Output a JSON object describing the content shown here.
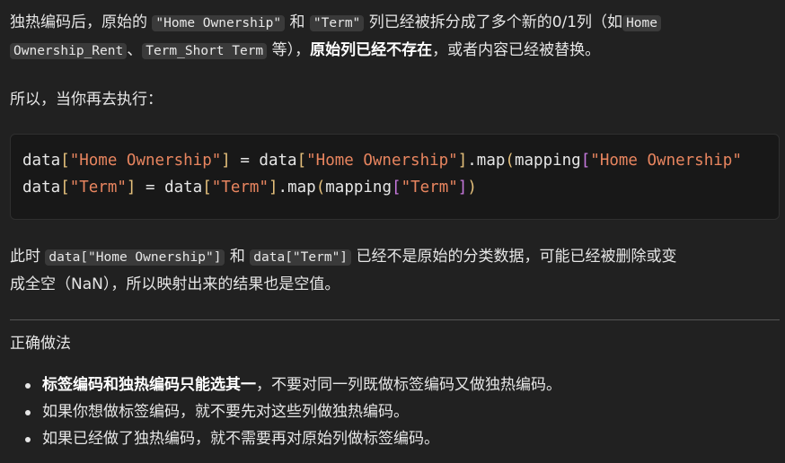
{
  "p1": {
    "a": "独热编码后，原始的",
    "code1": "\"Home Ownership\"",
    "b": "和",
    "code2": "\"Term\"",
    "c": "列已经被拆分成了多个新的0/1列（如",
    "code3a": "Home",
    "code3b": "Ownership_Rent",
    "d": "、",
    "code4": "Term_Short Term",
    "e": "等），",
    "bold": "原始列已经不存在",
    "f": "，或者内容已经被替换。"
  },
  "p2": "所以，当你再去执行：",
  "code_block": {
    "line1": {
      "t1": "data",
      "t2": "[",
      "t3": "\"Home Ownership\"",
      "t4": "]",
      "t5": " = data",
      "t6": "[",
      "t7": "\"Home Ownership\"",
      "t8": "]",
      "t9": ".map",
      "t10": "(",
      "t11": "mapping",
      "t12": "[",
      "t13": "\"Home Ownership\""
    },
    "line2": {
      "t1": "data",
      "t2": "[",
      "t3": "\"Term\"",
      "t4": "]",
      "t5": " = data",
      "t6": "[",
      "t7": "\"Term\"",
      "t8": "]",
      "t9": ".map",
      "t10": "(",
      "t11": "mapping",
      "t12": "[",
      "t13": "\"Term\"",
      "t14": "]",
      "t15": ")"
    }
  },
  "p3": {
    "a": "此时",
    "code1": "data[\"Home Ownership\"]",
    "b": "和",
    "code2": "data[\"Term\"]",
    "c": "已经不是原始的分类数据，可能已经被删除或变",
    "d": "成全空（NaN），所以映射出来的结果也是空值。"
  },
  "heading": "正确做法",
  "bullets": {
    "b1_bold": "标签编码和独热编码只能选其一",
    "b1_rest": "，不要对同一列既做标签编码又做独热编码。",
    "b2": "如果你想做标签编码，就不要先对这些列做独热编码。",
    "b3": "如果已经做了独热编码，就不需要再对原始列做标签编码。"
  }
}
